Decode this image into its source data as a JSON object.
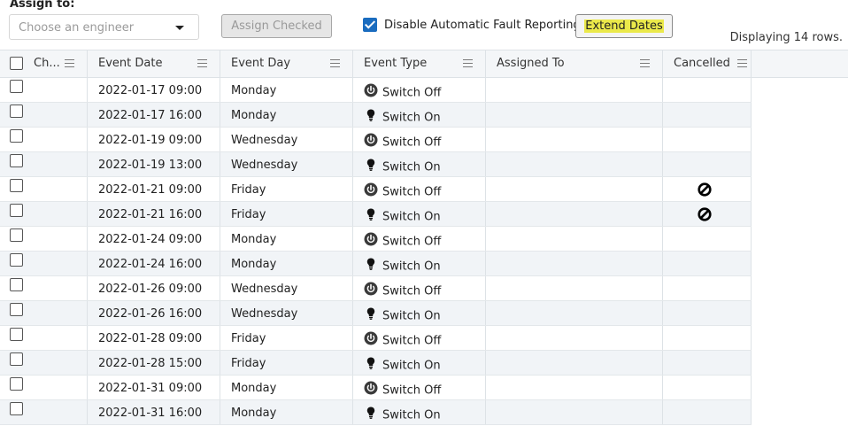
{
  "toolbar": {
    "assign_label": "Assign to:",
    "engineer_placeholder": "Choose an engineer",
    "assign_checked_label": "Assign Checked",
    "disable_fault_label": "Disable Automatic Fault Reporting",
    "disable_fault_checked": true,
    "extend_dates_label": "Extend Dates",
    "row_count_text": "Displaying 14 rows."
  },
  "columns": [
    "Ch...",
    "Event Date",
    "Event Day",
    "Event Type",
    "Assigned To",
    "Cancelled"
  ],
  "rows": [
    {
      "date": "2022-01-17 09:00",
      "day": "Monday",
      "type": "Switch Off",
      "icon": "power-icon",
      "assigned": "",
      "cancelled": false
    },
    {
      "date": "2022-01-17 16:00",
      "day": "Monday",
      "type": "Switch On",
      "icon": "lightbulb-icon",
      "assigned": "",
      "cancelled": false
    },
    {
      "date": "2022-01-19 09:00",
      "day": "Wednesday",
      "type": "Switch Off",
      "icon": "power-icon",
      "assigned": "",
      "cancelled": false
    },
    {
      "date": "2022-01-19 13:00",
      "day": "Wednesday",
      "type": "Switch On",
      "icon": "lightbulb-icon",
      "assigned": "",
      "cancelled": false
    },
    {
      "date": "2022-01-21 09:00",
      "day": "Friday",
      "type": "Switch Off",
      "icon": "power-icon",
      "assigned": "",
      "cancelled": true
    },
    {
      "date": "2022-01-21 16:00",
      "day": "Friday",
      "type": "Switch On",
      "icon": "lightbulb-icon",
      "assigned": "",
      "cancelled": true
    },
    {
      "date": "2022-01-24 09:00",
      "day": "Monday",
      "type": "Switch Off",
      "icon": "power-icon",
      "assigned": "",
      "cancelled": false
    },
    {
      "date": "2022-01-24 16:00",
      "day": "Monday",
      "type": "Switch On",
      "icon": "lightbulb-icon",
      "assigned": "",
      "cancelled": false
    },
    {
      "date": "2022-01-26 09:00",
      "day": "Wednesday",
      "type": "Switch Off",
      "icon": "power-icon",
      "assigned": "",
      "cancelled": false
    },
    {
      "date": "2022-01-26 16:00",
      "day": "Wednesday",
      "type": "Switch On",
      "icon": "lightbulb-icon",
      "assigned": "",
      "cancelled": false
    },
    {
      "date": "2022-01-28 09:00",
      "day": "Friday",
      "type": "Switch Off",
      "icon": "power-icon",
      "assigned": "",
      "cancelled": false
    },
    {
      "date": "2022-01-28 15:00",
      "day": "Friday",
      "type": "Switch On",
      "icon": "lightbulb-icon",
      "assigned": "",
      "cancelled": false
    },
    {
      "date": "2022-01-31 09:00",
      "day": "Monday",
      "type": "Switch Off",
      "icon": "power-icon",
      "assigned": "",
      "cancelled": false
    },
    {
      "date": "2022-01-31 16:00",
      "day": "Monday",
      "type": "Switch On",
      "icon": "lightbulb-icon",
      "assigned": "",
      "cancelled": false
    }
  ],
  "colors": {
    "accent": "#1a6cbf",
    "highlight": "#ebe94a",
    "alt_row": "#f1f4f7"
  }
}
